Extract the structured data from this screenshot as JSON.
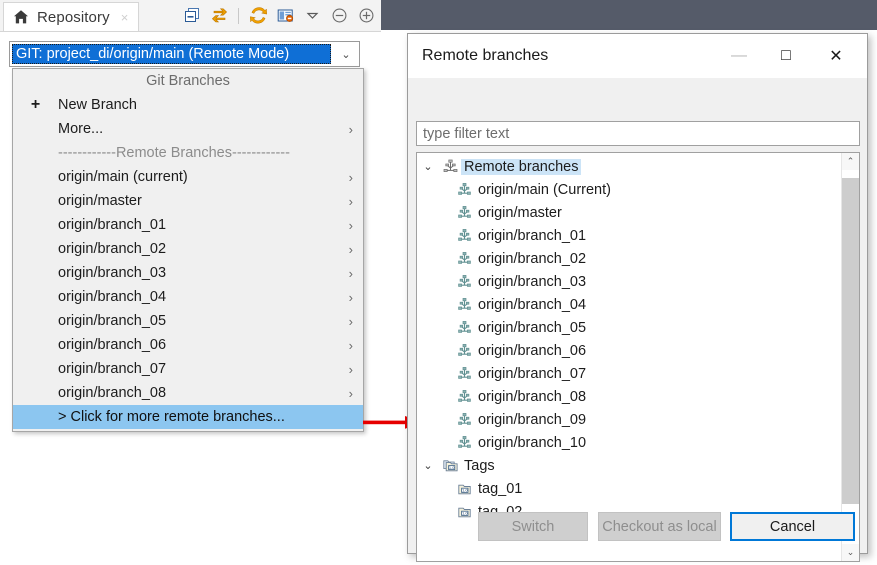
{
  "window": {
    "tab": {
      "label": "Repository",
      "icon": "home-icon",
      "close_glyph": "×"
    },
    "toolbar": [
      {
        "name": "collapse-all-icon"
      },
      {
        "name": "synchronize-icon"
      },
      {
        "name": "refresh-icon"
      },
      {
        "name": "show-properties-icon"
      },
      {
        "name": "view-menu-chevron-icon"
      },
      {
        "name": "minimize-icon"
      },
      {
        "name": "maximize-icon"
      }
    ]
  },
  "combo": {
    "value": "GIT: project_di/origin/main   (Remote Mode)",
    "arrow_glyph": "⌄"
  },
  "dropdown": {
    "header": "Git Branches",
    "items": [
      {
        "lead": "+",
        "label": "New Branch",
        "chevron": "",
        "selected": false
      },
      {
        "lead": "",
        "label": "More...",
        "chevron": "›",
        "selected": false
      },
      {
        "separator": "------------Remote Branches------------"
      },
      {
        "lead": "",
        "label": "origin/main (current)",
        "chevron": "›",
        "selected": false
      },
      {
        "lead": "",
        "label": "origin/master",
        "chevron": "›",
        "selected": false
      },
      {
        "lead": "",
        "label": "origin/branch_01",
        "chevron": "›",
        "selected": false
      },
      {
        "lead": "",
        "label": "origin/branch_02",
        "chevron": "›",
        "selected": false
      },
      {
        "lead": "",
        "label": "origin/branch_03",
        "chevron": "›",
        "selected": false
      },
      {
        "lead": "",
        "label": "origin/branch_04",
        "chevron": "›",
        "selected": false
      },
      {
        "lead": "",
        "label": "origin/branch_05",
        "chevron": "›",
        "selected": false
      },
      {
        "lead": "",
        "label": "origin/branch_06",
        "chevron": "›",
        "selected": false
      },
      {
        "lead": "",
        "label": "origin/branch_07",
        "chevron": "›",
        "selected": false
      },
      {
        "lead": "",
        "label": "origin/branch_08",
        "chevron": "›",
        "selected": false
      },
      {
        "lead": "",
        "label": "> Click for more remote branches...",
        "chevron": "",
        "selected": true
      }
    ]
  },
  "annotation": {
    "arrow_color": "#e60000",
    "name": "red-pointer-arrow"
  },
  "dialog": {
    "title": "Remote branches",
    "minimize_glyph": "—",
    "maximize_glyph": "□",
    "close_glyph": "✕",
    "filter": {
      "placeholder": "type filter text",
      "value": ""
    },
    "tree": [
      {
        "label": "Remote branches",
        "level": 0,
        "twisty": "⌄",
        "icon": "git-branches-root-icon",
        "selected": true
      },
      {
        "label": "origin/main (Current)",
        "level": 1,
        "twisty": "",
        "icon": "git-branch-icon",
        "selected": false
      },
      {
        "label": "origin/master",
        "level": 1,
        "twisty": "",
        "icon": "git-branch-icon",
        "selected": false
      },
      {
        "label": "origin/branch_01",
        "level": 1,
        "twisty": "",
        "icon": "git-branch-icon",
        "selected": false
      },
      {
        "label": "origin/branch_02",
        "level": 1,
        "twisty": "",
        "icon": "git-branch-icon",
        "selected": false
      },
      {
        "label": "origin/branch_03",
        "level": 1,
        "twisty": "",
        "icon": "git-branch-icon",
        "selected": false
      },
      {
        "label": "origin/branch_04",
        "level": 1,
        "twisty": "",
        "icon": "git-branch-icon",
        "selected": false
      },
      {
        "label": "origin/branch_05",
        "level": 1,
        "twisty": "",
        "icon": "git-branch-icon",
        "selected": false
      },
      {
        "label": "origin/branch_06",
        "level": 1,
        "twisty": "",
        "icon": "git-branch-icon",
        "selected": false
      },
      {
        "label": "origin/branch_07",
        "level": 1,
        "twisty": "",
        "icon": "git-branch-icon",
        "selected": false
      },
      {
        "label": "origin/branch_08",
        "level": 1,
        "twisty": "",
        "icon": "git-branch-icon",
        "selected": false
      },
      {
        "label": "origin/branch_09",
        "level": 1,
        "twisty": "",
        "icon": "git-branch-icon",
        "selected": false
      },
      {
        "label": "origin/branch_10",
        "level": 1,
        "twisty": "",
        "icon": "git-branch-icon",
        "selected": false
      },
      {
        "label": "Tags",
        "level": 0,
        "twisty": "⌄",
        "icon": "tags-folder-icon",
        "selected": false
      },
      {
        "label": "tag_01",
        "level": 1,
        "twisty": "",
        "icon": "tag-icon",
        "selected": false
      },
      {
        "label": "tag_02",
        "level": 1,
        "twisty": "",
        "icon": "tag-icon",
        "selected": false
      }
    ],
    "scrollbar": {
      "up_glyph": "⌃",
      "down_glyph": "⌄"
    },
    "buttons": {
      "switch": {
        "label": "Switch",
        "enabled": false
      },
      "checkout": {
        "label": "Checkout as local",
        "enabled": false
      },
      "cancel": {
        "label": "Cancel",
        "enabled": true,
        "focus_color": "#0078d7"
      }
    }
  }
}
